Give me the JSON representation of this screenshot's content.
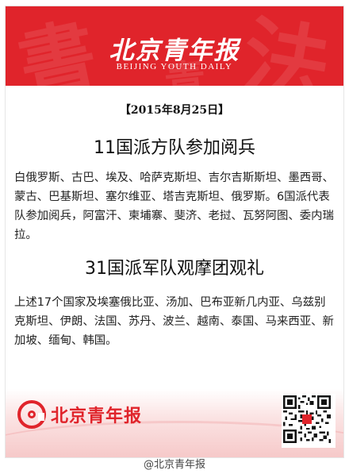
{
  "header": {
    "logo_cn": "北京青年报",
    "logo_en": "BEIJING YOUTH DAILY"
  },
  "article": {
    "date": "【2015年8月25日】",
    "heading1": "11国派方队参加阅兵",
    "paragraph1": "白俄罗斯、古巴、埃及、哈萨克斯坦、吉尔吉斯斯坦、墨西哥、蒙古、巴基斯坦、塞尔维亚、塔吉克斯坦、俄罗斯。6国派代表队参加阅兵，阿富汗、柬埔寨、斐济、老挝、瓦努阿图、委内瑞拉。",
    "heading2": "31国派军队观摩团观礼",
    "paragraph2": "上述17个国家及埃塞俄比亚、汤加、巴布亚新几内亚、乌兹别克斯坦、伊朗、法国、苏丹、波兰、越南、泰国、马来西亚、新加坡、缅甸、韩国。"
  },
  "footer": {
    "brand": "北京青年报",
    "brand_icon": "at-sign-icon",
    "watermark": "@北京青年报"
  },
  "colors": {
    "brand_red": "#e0242b"
  }
}
